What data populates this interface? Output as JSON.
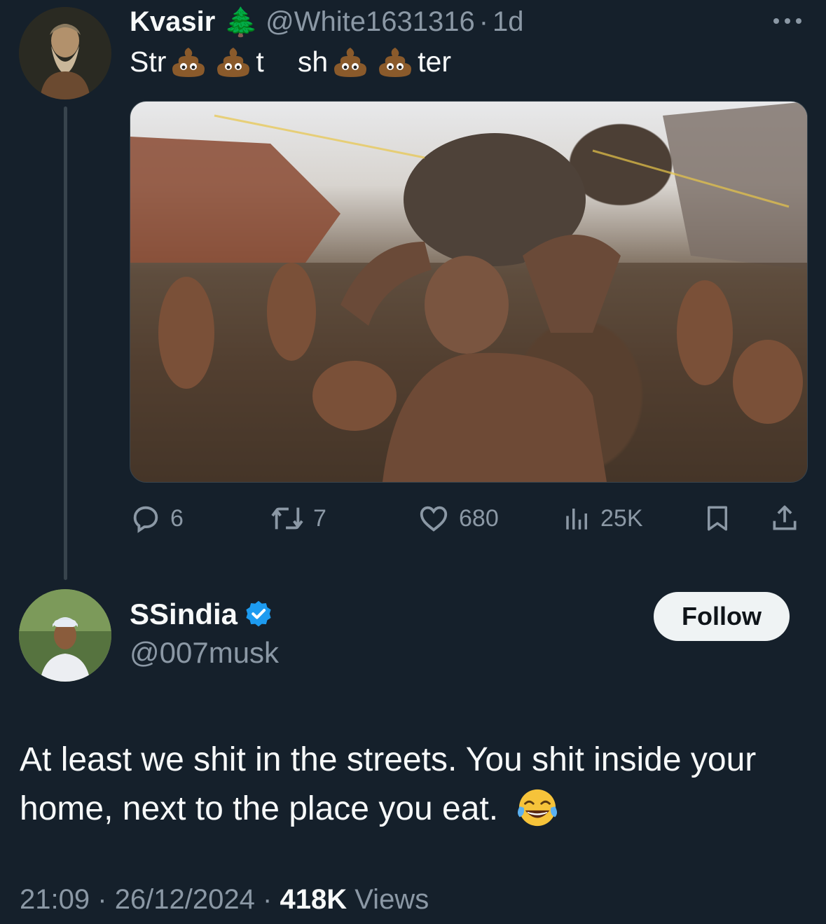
{
  "original_tweet": {
    "display_name": "Kvasir",
    "name_emoji": "🌲",
    "handle": "@White1631316",
    "separator": "·",
    "age": "1d",
    "text_parts": [
      "Str",
      "t",
      "sh",
      "ter"
    ],
    "text_emoji": "poo-emoji",
    "more_icon": "ellipsis-icon",
    "stats": {
      "replies": "6",
      "retweets": "7",
      "likes": "680",
      "views": "25K"
    }
  },
  "reply_tweet": {
    "display_name": "SSindia",
    "verified": true,
    "handle": "@007musk",
    "follow_label": "Follow",
    "text": "At least we shit in the streets. You shit inside your home, next to the place you eat.",
    "text_emoji": "😂",
    "time": "21:09",
    "date": "26/12/2024",
    "sep": "·",
    "views_count": "418K",
    "views_label": "Views"
  },
  "colors": {
    "background": "#15202b",
    "text": "#f7f9f9",
    "muted": "#8b98a5",
    "verified": "#1d9bf0",
    "follow_bg": "#eff3f4"
  }
}
